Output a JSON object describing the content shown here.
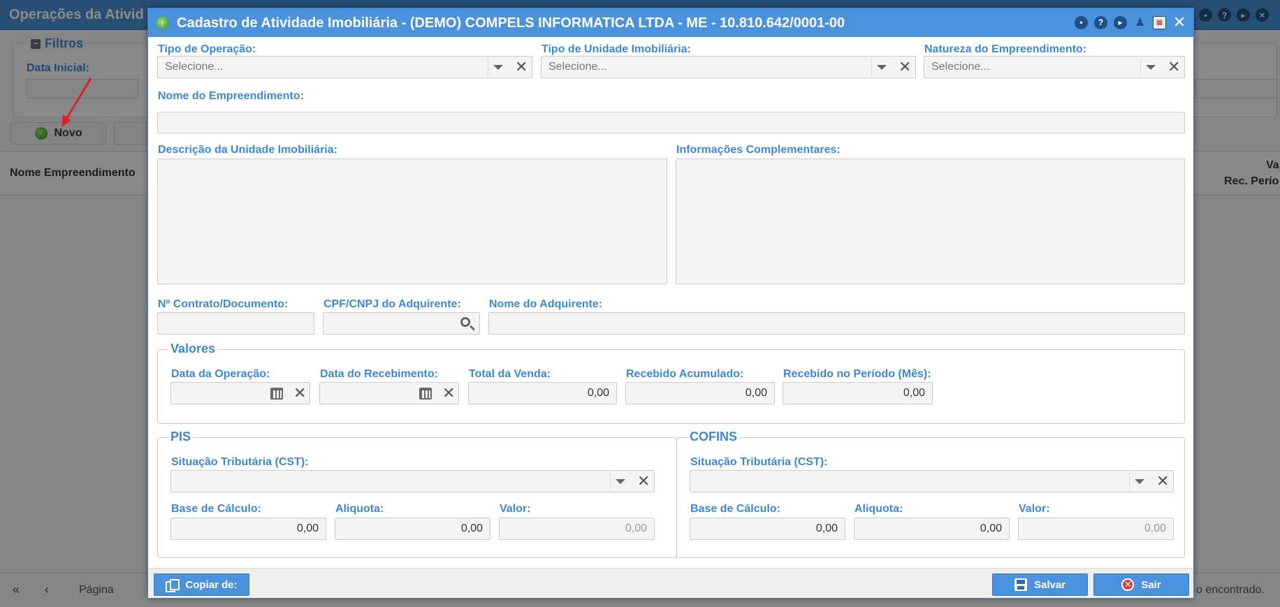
{
  "background": {
    "title": "Operações da Ativid",
    "filters_legend": "Filtros",
    "data_inicial_label": "Data Inicial:",
    "novo_label": "Novo",
    "col_nome": "Nome Empreendimento",
    "col_val": "Va",
    "col_rec": "Rec. Perío",
    "footer_pagina": "Página",
    "footer_status": "o encontrado."
  },
  "dialog": {
    "title": "Cadastro de Atividade Imobiliária - (DEMO) COMPELS INFORMATICA LTDA - ME - 10.810.642/0001-00",
    "tipo_operacao": {
      "label": "Tipo de Operação:",
      "placeholder": "Selecione..."
    },
    "tipo_unidade": {
      "label": "Tipo de Unidade Imobiliária:",
      "placeholder": "Selecione..."
    },
    "natureza": {
      "label": "Natureza do Empreendimento:",
      "placeholder": "Selecione..."
    },
    "nome_empreendimento": {
      "label": "Nome do Empreendimento:",
      "value": ""
    },
    "descricao_unidade": {
      "label": "Descrição da Unidade Imobiliária:",
      "value": ""
    },
    "info_complementares": {
      "label": "Informações Complementares:",
      "value": ""
    },
    "contrato": {
      "label": "Nº Contrato/Documento:",
      "value": ""
    },
    "cpf_cnpj": {
      "label": "CPF/CNPJ do Adquirente:",
      "value": ""
    },
    "nome_adquirente": {
      "label": "Nome do Adquirente:",
      "value": ""
    },
    "valores": {
      "legend": "Valores",
      "data_operacao": {
        "label": "Data da Operação:",
        "value": ""
      },
      "data_recebimento": {
        "label": "Data do Recebimento:",
        "value": ""
      },
      "total_venda": {
        "label": "Total da Venda:",
        "value": "0,00"
      },
      "recebido_acumulado": {
        "label": "Recebido Acumulado:",
        "value": "0,00"
      },
      "recebido_periodo": {
        "label": "Recebido no Período (Mês):",
        "value": "0,00"
      }
    },
    "pis": {
      "legend": "PIS",
      "cst_label": "Situação Tributária (CST):",
      "base_label": "Base de Cálculo:",
      "base_value": "0,00",
      "aliquota_label": "Aliquota:",
      "aliquota_value": "0,00",
      "valor_label": "Valor:",
      "valor_value": "0,00"
    },
    "cofins": {
      "legend": "COFINS",
      "cst_label": "Situação Tributária (CST):",
      "base_label": "Base de Cálculo:",
      "base_value": "0,00",
      "aliquota_label": "Aliquota:",
      "aliquota_value": "0,00",
      "valor_label": "Valor:",
      "valor_value": "0,00"
    },
    "footer": {
      "copiar_label": "Copiar de:",
      "salvar_label": "Salvar",
      "sair_label": "Sair"
    }
  },
  "colors": {
    "primary": "#4a92dc",
    "label": "#3e88d0",
    "overlay": "#000000"
  }
}
